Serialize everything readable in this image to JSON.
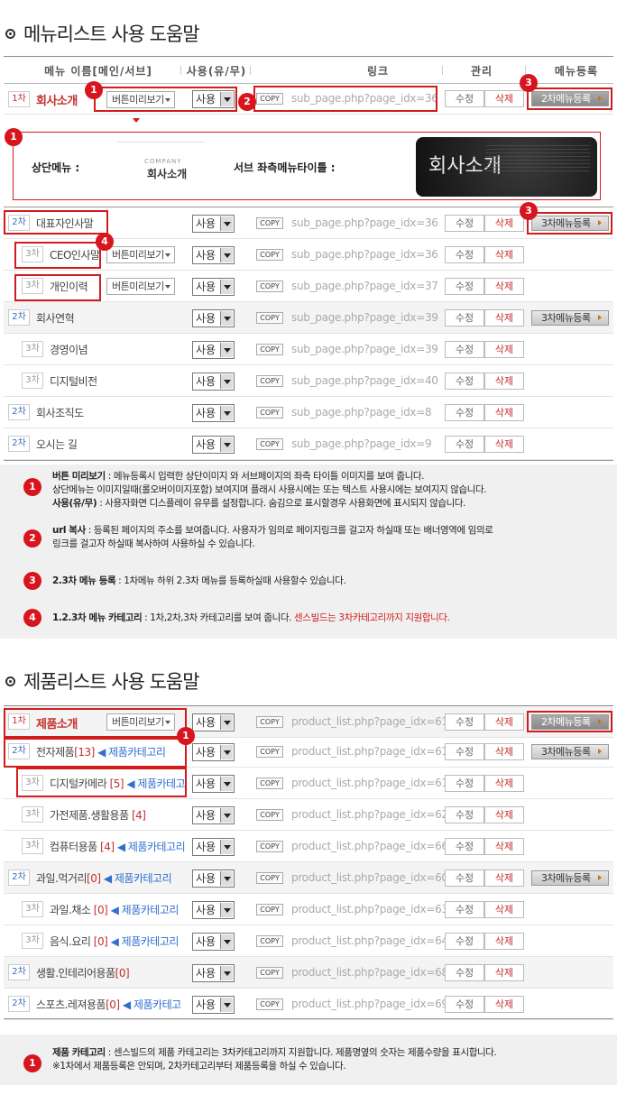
{
  "menu_section": {
    "title": "메뉴리스트 사용 도움말",
    "headers": {
      "name": "메뉴 이름[메인/서브]",
      "use": "사용(유/무)",
      "link": "링크",
      "manage": "관리",
      "register": "메뉴등록"
    },
    "top_row": {
      "level": "1차",
      "name": "회사소개",
      "preview": "버튼미리보기",
      "use": "사용",
      "copy": "COPY",
      "link": "sub_page.php?page_idx=36",
      "edit": "수정",
      "delete": "삭제",
      "register": "2차메뉴등록"
    },
    "preview_panel": {
      "top_menu_label": "상단메뉴 :",
      "company_small": "COMPANY",
      "company_big": "회사소개",
      "sub_title_label": "서브 좌측메뉴타이틀 :",
      "banner_text": "회사소개"
    },
    "rows": [
      {
        "level": "2차",
        "name": "대표자인사말",
        "use": "사용",
        "copy": "COPY",
        "link": "sub_page.php?page_idx=36",
        "edit": "수정",
        "delete": "삭제",
        "register": "3차메뉴등록"
      },
      {
        "level": "3차",
        "name": "CEO인사말",
        "preview": "버튼미리보기",
        "use": "사용",
        "copy": "COPY",
        "link": "sub_page.php?page_idx=36",
        "edit": "수정",
        "delete": "삭제"
      },
      {
        "level": "3차",
        "name": "개인이력",
        "preview": "버튼미리보기",
        "use": "사용",
        "copy": "COPY",
        "link": "sub_page.php?page_idx=37",
        "edit": "수정",
        "delete": "삭제"
      },
      {
        "level": "2차",
        "name": "회사연혁",
        "use": "사용",
        "copy": "COPY",
        "link": "sub_page.php?page_idx=39",
        "edit": "수정",
        "delete": "삭제",
        "register": "3차메뉴등록"
      },
      {
        "level": "3차",
        "name": "경영이념",
        "use": "사용",
        "copy": "COPY",
        "link": "sub_page.php?page_idx=39",
        "edit": "수정",
        "delete": "삭제"
      },
      {
        "level": "3차",
        "name": "디지털비전",
        "use": "사용",
        "copy": "COPY",
        "link": "sub_page.php?page_idx=40",
        "edit": "수정",
        "delete": "삭제"
      },
      {
        "level": "2차",
        "name": "회사조직도",
        "use": "사용",
        "copy": "COPY",
        "link": "sub_page.php?page_idx=8",
        "edit": "수정",
        "delete": "삭제"
      },
      {
        "level": "2차",
        "name": "오시는 길",
        "use": "사용",
        "copy": "COPY",
        "link": "sub_page.php?page_idx=9",
        "edit": "수정",
        "delete": "삭제"
      }
    ],
    "help": [
      {
        "num": "1",
        "bold1": "버튼 미리보기",
        "text1": " : 메뉴등록시 입력한 상단이미지 와 서브페이지의 좌측 타이틀 이미지를 보여 줍니다.",
        "text2": "상단메뉴는 이미지일때(롤오버이미지포함) 보여지며 플래시 사용시에는 또는 텍스트 사용시에는 보여지지 않습니다.",
        "bold3": "사용(유/무)",
        "text3": " : 사용자화면 디스플레이 유무를 설정합니다. 숨김으로 표시할경우 사용화면에 표시되지 않습니다."
      },
      {
        "num": "2",
        "bold1": "url 복사",
        "text1": " : 등록된 페이지의 주소를 보여줍니다. 사용자가 임의로 페이지링크를 걸고자 하실때 또는 배너영역에 임의로",
        "text2": "링크를 걸고자 하실때 복사하여 사용하실 수 있습니다."
      },
      {
        "num": "3",
        "bold1": "2.3차 메뉴 등록",
        "text1": " : 1차메뉴 하위 2.3차 메뉴를 등록하실때 사용할수 있습니다."
      },
      {
        "num": "4",
        "bold1": "1.2.3차 메뉴 카테고리",
        "text1": " : 1차,2차,3차 카테고리를 보여 줍니다. ",
        "red": "센스빌드는 3차카테고리까지 지원합니다."
      }
    ]
  },
  "product_section": {
    "title": "제품리스트 사용 도움말",
    "rows": [
      {
        "level": "1차",
        "name": "제품소개",
        "preview": "버튼미리보기",
        "use": "사용",
        "copy": "COPY",
        "link": "product_list.php?page_idx=61",
        "edit": "수정",
        "delete": "삭제",
        "register": "2차메뉴등록"
      },
      {
        "level": "2차",
        "name": "전자제품",
        "count": "[13]",
        "cat": " ◀ 제품카테고리",
        "use": "사용",
        "copy": "COPY",
        "link": "product_list.php?page_idx=61",
        "edit": "수정",
        "delete": "삭제",
        "register": "3차메뉴등록"
      },
      {
        "level": "3차",
        "name": "디지털카메라 ",
        "count": "[5]",
        "cat": " ◀ 제품카테고",
        "use": "사용",
        "copy": "COPY",
        "link": "product_list.php?page_idx=61",
        "edit": "수정",
        "delete": "삭제"
      },
      {
        "level": "3차",
        "name": "가전제품.생활용품 ",
        "count": "[4]",
        "cat": "",
        "use": "사용",
        "copy": "COPY",
        "link": "product_list.php?page_idx=62",
        "edit": "수정",
        "delete": "삭제"
      },
      {
        "level": "3차",
        "name": "컴퓨터용품 ",
        "count": "[4]",
        "cat": " ◀ 제품카테고리",
        "use": "사용",
        "copy": "COPY",
        "link": "product_list.php?page_idx=66",
        "edit": "수정",
        "delete": "삭제"
      },
      {
        "level": "2차",
        "name": "과일.먹거리",
        "count": "[0]",
        "cat": " ◀ 제품카테고리",
        "use": "사용",
        "copy": "COPY",
        "link": "product_list.php?page_idx=60",
        "edit": "수정",
        "delete": "삭제",
        "register": "3차메뉴등록"
      },
      {
        "level": "3차",
        "name": "과일.채소 ",
        "count": "[0]",
        "cat": " ◀ 제품카테고리",
        "use": "사용",
        "copy": "COPY",
        "link": "product_list.php?page_idx=63",
        "edit": "수정",
        "delete": "삭제"
      },
      {
        "level": "3차",
        "name": "음식.요리 ",
        "count": "[0]",
        "cat": " ◀ 제품카테고리",
        "use": "사용",
        "copy": "COPY",
        "link": "product_list.php?page_idx=64",
        "edit": "수정",
        "delete": "삭제"
      },
      {
        "level": "2차",
        "name": "생활.인테리어용품",
        "count": "[0]",
        "cat": "",
        "use": "사용",
        "copy": "COPY",
        "link": "product_list.php?page_idx=68",
        "edit": "수정",
        "delete": "삭제"
      },
      {
        "level": "2차",
        "name": "스포츠.레져용품",
        "count": "[0]",
        "cat": " ◀ 제품카테고",
        "use": "사용",
        "copy": "COPY",
        "link": "product_list.php?page_idx=69",
        "edit": "수정",
        "delete": "삭제"
      }
    ],
    "help": {
      "num": "1",
      "bold1": "제품 카테고리",
      "text1": " : 센스빌드의 제품 카테고리는 3차카테고리까지 지원합니다. 제품명옆의 숫자는 제품수량을 표시합니다.",
      "text2": "※1차에서 제품등록은 안되며, 2차카테고리부터 제품등록을 하실 수 있습니다."
    }
  },
  "colors": {
    "accent_red": "#d21c1c",
    "link_gray": "#aaaaaa",
    "category_blue": "#2f6fd0"
  }
}
